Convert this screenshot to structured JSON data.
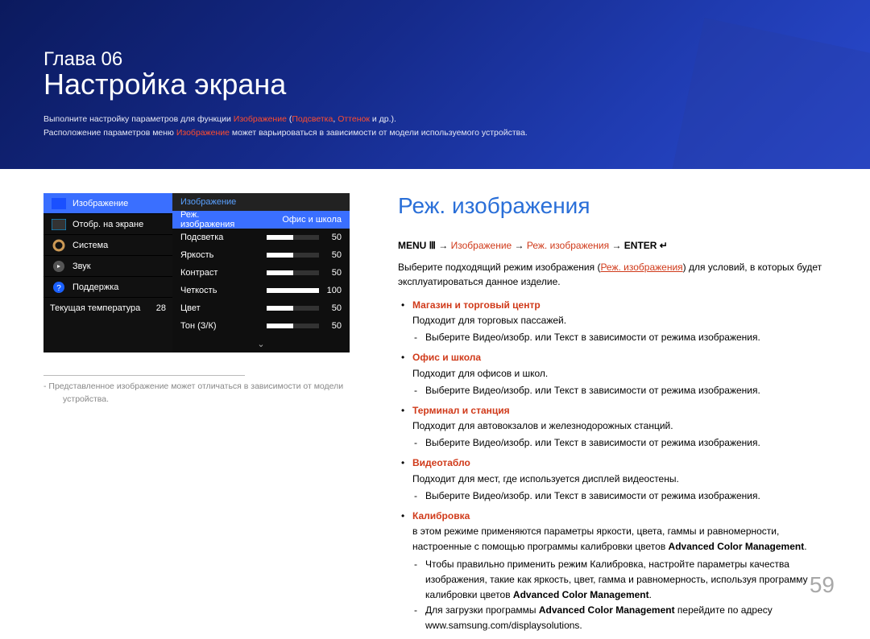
{
  "banner": {
    "chapter": "Глава 06",
    "title": "Настройка экрана",
    "line1_a": "Выполните настройку параметров для функции ",
    "line1_h1": "Изображение",
    "line1_b": " (",
    "line1_h2": "Подсветка",
    "line1_c": ", ",
    "line1_h3": "Оттенок",
    "line1_d": " и др.).",
    "line2_a": "Расположение параметров меню ",
    "line2_h": "Изображение",
    "line2_b": " может варьироваться в зависимости от модели используемого устройства."
  },
  "osd": {
    "sidebar": [
      {
        "label": "Изображение"
      },
      {
        "label": "Отобр. на экране"
      },
      {
        "label": "Система"
      },
      {
        "label": "Звук"
      },
      {
        "label": "Поддержка"
      }
    ],
    "temp_label": "Текущая температура",
    "temp_val": "28",
    "panel_title": "Изображение",
    "sel_label": "Реж. изображения",
    "sel_val": "Офис и школа",
    "rows": [
      {
        "label": "Подсветка",
        "val": "50",
        "cls": "s50"
      },
      {
        "label": "Яркость",
        "val": "50",
        "cls": "s50"
      },
      {
        "label": "Контраст",
        "val": "50",
        "cls": "s50"
      },
      {
        "label": "Четкость",
        "val": "100",
        "cls": "s100"
      },
      {
        "label": "Цвет",
        "val": "50",
        "cls": "s50"
      },
      {
        "label": "Тон (З/К)",
        "val": "50",
        "cls": "s50"
      }
    ]
  },
  "footnote_a": "‑ Представленное изображение может отличаться в зависимости от модели",
  "footnote_b": "устройства.",
  "section_title": "Реж. изображения",
  "path": {
    "menu": "MENU ",
    "menu_icon": "Ⅲ",
    "arrow": " → ",
    "p1": "Изображение",
    "p2": "Реж. изображения",
    "enter": "ENTER ",
    "enter_icon": "↵"
  },
  "intro_a": "Выберите подходящий режим изображения (",
  "intro_mode": "Реж. изображения",
  "intro_b": ") для условий, в которых будет эксплуатироваться данное изделие.",
  "modes": [
    {
      "title": "Магазин и торговый центр",
      "desc": "Подходит для торговых пассажей.",
      "sub_a": "Выберите ",
      "sub_v": "Видео/изобр.",
      "sub_b": " или ",
      "sub_t": "Текст",
      "sub_c": " в зависимости от режима изображения."
    },
    {
      "title": "Офис и школа",
      "desc": "Подходит для офисов и школ.",
      "sub_a": "Выберите ",
      "sub_v": "Видео/изобр.",
      "sub_b": " или ",
      "sub_t": "Текст",
      "sub_c": " в зависимости от режима изображения."
    },
    {
      "title": "Терминал и станция",
      "desc": "Подходит для автовокзалов и железнодорожных станций.",
      "sub_a": "Выберите ",
      "sub_v": "Видео/изобр.",
      "sub_b": " или ",
      "sub_t": "Текст",
      "sub_c": " в зависимости от режима изображения."
    },
    {
      "title": "Видеотабло",
      "desc": "Подходит для мест, где используется дисплей видеостены.",
      "sub_a": "Выберите ",
      "sub_v": "Видео/изобр.",
      "sub_b": " или ",
      "sub_t": "Текст",
      "sub_c": " в зависимости от режима изображения."
    }
  ],
  "calib": {
    "title": "Калибровка",
    "l1_a": "в этом режиме применяются параметры яркости, цвета, гаммы и равномерности, настроенные с помощью программы калибровки цветов ",
    "l1_b": "Advanced Color Management",
    "s1_a": "Чтобы правильно применить режим ",
    "s1_k": "Калибровка",
    "s1_b": ", настройте параметры качества изображения, такие как яркость, цвет, гамма и равномерность, используя программу калибровки цветов ",
    "s1_c": "Advanced Color Management",
    "s2_a": "Для загрузки программы ",
    "s2_b": "Advanced Color Management",
    "s2_c": " перейдите по адресу www.samsung.com/displaysolutions."
  },
  "page": "59"
}
